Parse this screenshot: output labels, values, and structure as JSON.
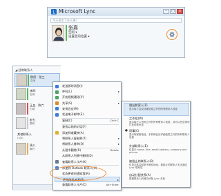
{
  "top_window": {
    "title": "Microsoft Lync",
    "window_buttons": [
      "–",
      "□",
      "×"
    ],
    "status_placeholder": "今天发生了什么事?",
    "user": {
      "name": "张嘉",
      "presence": "空闲 ▾",
      "location": "设置您的位置 ▾"
    },
    "icons": {
      "gear": "gear-icon",
      "logo": "lync-logo-icon"
    },
    "highlight_color": "#f08a2e"
  },
  "contact_window": {
    "group_header": "◢ 经常联系人",
    "contacts": [
      {
        "name": "欧阳 · 张三",
        "status": "空闲",
        "presence_color": "#5cb85c"
      },
      {
        "name": "李四",
        "status": "空闲",
        "presence_color": "#5cb85c"
      },
      {
        "name": "王五 · 陈六",
        "status": "忙碌",
        "presence_color": "#d9534f"
      },
      {
        "name": "赵七",
        "status": "脱机",
        "presence_color": "#c9c9c9"
      },
      {
        "name": "其他联系人",
        "status": "(3/5)",
        "presence_color": "#c9c9c9"
      },
      {
        "name": "周八",
        "status": "离开",
        "presence_color": "#f0ad4e"
      }
    ]
  },
  "context_menu": {
    "items": [
      {
        "label": "发送即时消息(I)",
        "shortcut": "",
        "arrow": false
      },
      {
        "label": "呼叫(L)",
        "shortcut": "",
        "arrow": true
      },
      {
        "label": "开始视频通话(V)",
        "shortcut": "",
        "arrow": false
      },
      {
        "label": "共享(S)",
        "shortcut": "",
        "arrow": true
      },
      {
        "label": "安排会议(M)",
        "shortcut": "",
        "arrow": false
      },
      {
        "label": "发送电子邮件(E)",
        "shortcut": "",
        "arrow": false
      },
      {
        "label": "复制(C)",
        "shortcut": "Ctrl+C",
        "arrow": false
      },
      {
        "label": "查找以前的对话(F)",
        "shortcut": "",
        "arrow": false
      },
      {
        "label": "添加到收藏夹(A)",
        "shortcut": "",
        "arrow": false
      },
      {
        "label": "将联系人复制到(T)",
        "shortcut": "",
        "arrow": true
      },
      {
        "label": "将联系人移到(O)",
        "shortcut": "",
        "arrow": true
      },
      {
        "label": "从组中删除(R)",
        "shortcut": "Delete",
        "arrow": false
      },
      {
        "label": "从联系人列表中删除(D)",
        "shortcut": "",
        "arrow": false
      },
      {
        "label": "查看联系人卡片(K)",
        "shortcut": "",
        "arrow": false
      },
      {
        "label": "添加到 Outlook 联系人(U)",
        "shortcut": "",
        "arrow": false
      },
      {
        "label": "状态更改时通知我(N)",
        "shortcut": "",
        "arrow": false
      },
      {
        "label": "更改隐私关系(P)",
        "shortcut": "",
        "arrow": true
      },
      {
        "label": "查看联系人卡片(C)",
        "shortcut": "Alt+Enter",
        "arrow": false
      }
    ]
  },
  "submenu": {
    "items": [
      {
        "title": "朋友和家人(F)",
        "desc": "显示除了会议详细信息之外的所有联系人信息",
        "checked": false
      },
      {
        "title": "工作组(W)",
        "desc": "显示除个人号码之外的所有联系人信息，并可以在您请勿打扰时联系您",
        "checked": false
      },
      {
        "title": "同事(C)",
        "desc": "显示除家庭电话、手机和会议详细信息之外的所有联系人信息",
        "checked": true
      },
      {
        "title": "外部联系人(E)",
        "desc": "仅显示 name, title, email address, company and picture",
        "checked": false
      },
      {
        "title": "被阻止的联系人(B)",
        "desc": "仅显示姓名和电子邮件地址；被阻止的联系人无法通过 Lync 联系您",
        "checked": false
      },
      {
        "title": "自动分配关系(A)",
        "desc": "根据联系人的情况分配 Lync 关系",
        "checked": false
      }
    ]
  }
}
